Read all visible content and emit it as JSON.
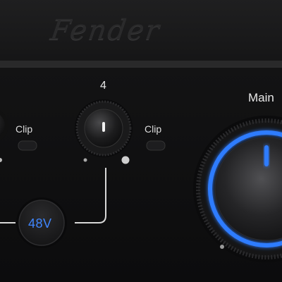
{
  "brand": {
    "logo": "Fender"
  },
  "labels": {
    "channel": "4",
    "clip_left": "Clip",
    "clip_right": "Clip",
    "main": "Main",
    "phantom": "48V"
  },
  "colors": {
    "accent_blue": "#2f7cff",
    "panel": "#0f0f10",
    "top_case": "#1b1b1c",
    "text": "#e8e8e8"
  },
  "icons": [
    "gain-knob-icon",
    "main-volume-knob-icon",
    "clip-led-icon",
    "phantom-power-button-icon"
  ]
}
